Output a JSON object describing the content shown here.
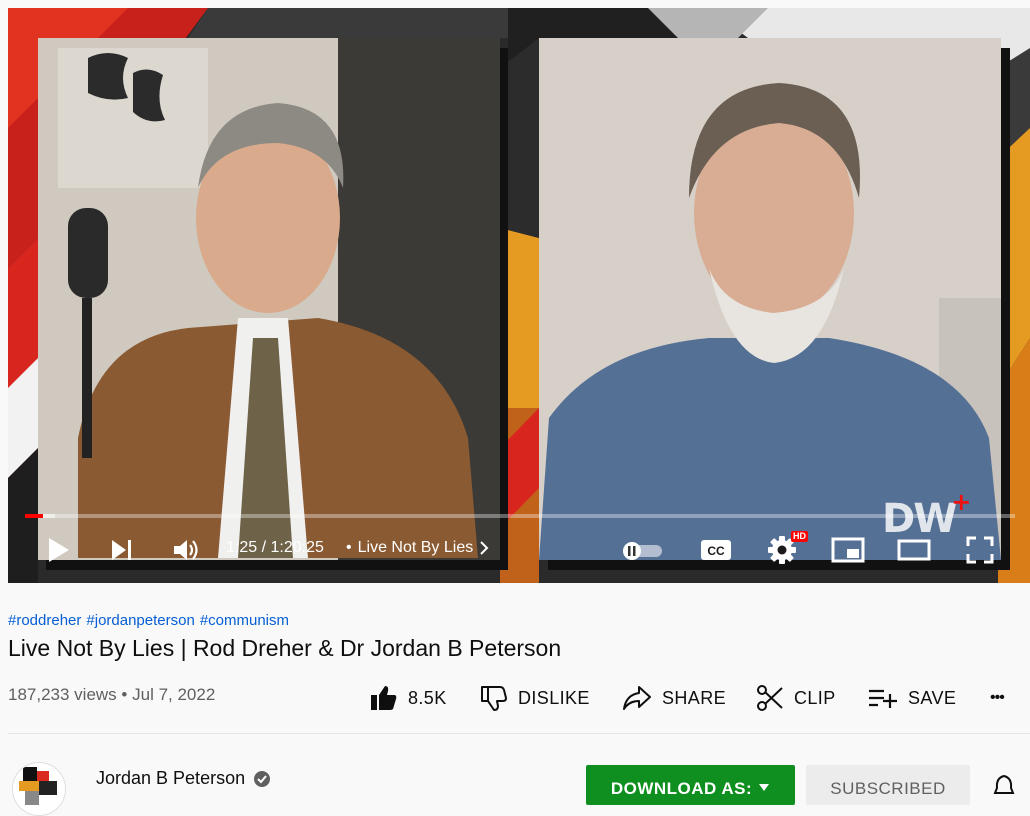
{
  "player": {
    "time_current": "1:25",
    "time_separator": " / ",
    "time_total": "1:20:25",
    "chapter_bullet": "•",
    "chapter_title": "Live Not By Lies",
    "hd_badge": "HD",
    "cc_label": "CC",
    "watermark": "DW",
    "watermark_plus": "+",
    "progress_played_fraction": 0.018,
    "progress_loaded_fraction": 0.03
  },
  "video": {
    "hashtags": [
      "#roddreher",
      "#jordanpeterson",
      "#communism"
    ],
    "title": "Live Not By Lies | Rod Dreher & Dr Jordan B Peterson",
    "views": "187,233 views",
    "meta_separator": "•",
    "date": "Jul 7, 2022"
  },
  "actions": {
    "like_count": "8.5K",
    "dislike_label": "DISLIKE",
    "share_label": "SHARE",
    "clip_label": "CLIP",
    "save_label": "SAVE",
    "more_label": "•••"
  },
  "channel": {
    "name": "Jordan B Peterson",
    "download_label": "DOWNLOAD AS:",
    "subscribed_label": "SUBSCRIBED"
  },
  "colors": {
    "accent_red": "#ff0000",
    "link_blue": "#065fd4",
    "download_green": "#0f8f1f"
  }
}
